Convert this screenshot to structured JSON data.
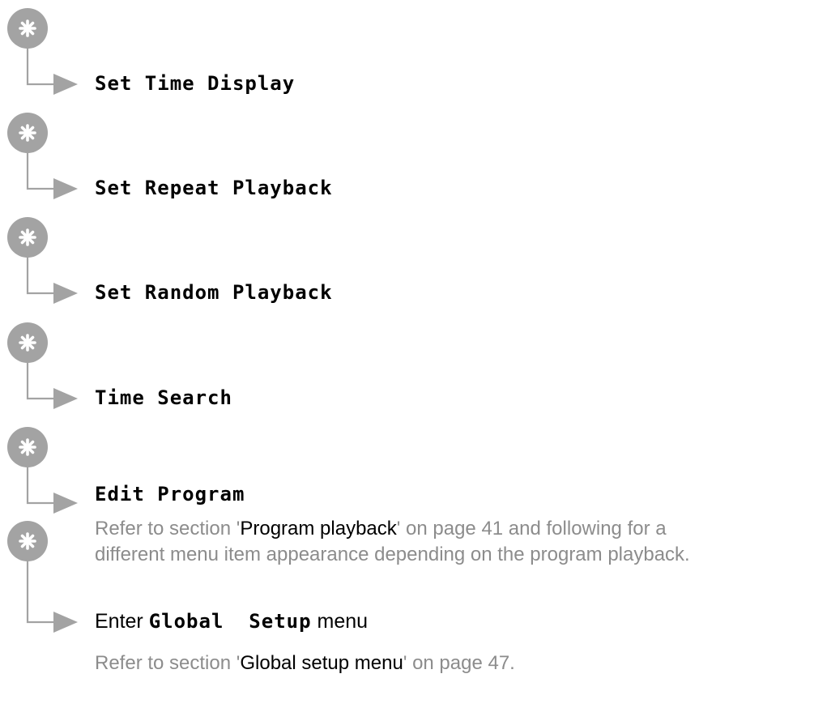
{
  "menu_items": [
    {
      "label": "Set Time Display"
    },
    {
      "label": "Set Repeat Playback"
    },
    {
      "label": "Set Random Playback"
    },
    {
      "label": "Time Search"
    },
    {
      "label": "Edit Program"
    }
  ],
  "edit_program_note": {
    "prefix": "Refer to section '",
    "link": "Program playback",
    "suffix": "' on page 41 and following for a",
    "line2": "different menu item appearance depending on the program playback."
  },
  "global_setup": {
    "enter": "Enter ",
    "menu_name": "Global  Setup",
    "menu": " menu",
    "note_prefix": "Refer to section '",
    "note_link": "Global setup menu",
    "note_suffix": "' on page 47."
  },
  "icons": {
    "button": "asterisk-button-icon",
    "arrow": "l-arrow-connector-icon"
  },
  "colors": {
    "button": "#a3a3a3",
    "connector": "#a3a3a3",
    "note_text": "#8c8c8c"
  }
}
